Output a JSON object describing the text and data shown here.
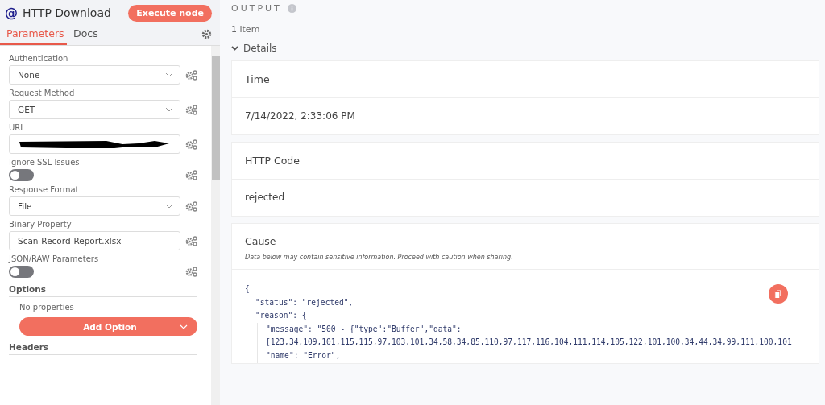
{
  "node": {
    "icon": "@",
    "title": "HTTP Download",
    "execute_button": "Execute node"
  },
  "tabs": [
    {
      "label": "Parameters",
      "selected": true
    },
    {
      "label": "Docs",
      "selected": false
    }
  ],
  "fields": [
    {
      "kind": "select",
      "label": "Authentication",
      "value": "None"
    },
    {
      "kind": "select",
      "label": "Request Method",
      "value": "GET"
    },
    {
      "kind": "redacted",
      "label": "URL"
    },
    {
      "kind": "toggle",
      "label": "Ignore SSL Issues",
      "on": false
    },
    {
      "kind": "select",
      "label": "Response Format",
      "value": "File"
    },
    {
      "kind": "input",
      "label": "Binary Property",
      "value": "Scan-Record-Report.xlsx"
    },
    {
      "kind": "toggle",
      "label": "JSON/RAW Parameters",
      "on": false
    }
  ],
  "options": {
    "title": "Options",
    "empty_text": "No properties",
    "add_button": "Add Option"
  },
  "headers": {
    "title": "Headers"
  },
  "output": {
    "title": "OUTPUT",
    "count": "1 item",
    "section": "Details",
    "expanded": true,
    "cards": [
      {
        "title": "Time",
        "value": "7/14/2022, 2:33:06 PM"
      },
      {
        "title": "HTTP Code",
        "value": "rejected"
      }
    ],
    "cause": {
      "title": "Cause",
      "note": "Data below may contain sensitive information. Proceed with caution when sharing.",
      "code": [
        {
          "text": "{",
          "children": [
            {
              "text": "\"status\": \"rejected\","
            },
            {
              "text": "\"reason\": {",
              "children": [
                {
                  "text": "\"message\": \"500 - {\"type\":\"Buffer\",\"data\":"
                },
                {
                  "text": "[123,34,109,101,115,115,97,103,101,34,58,34,85,110,97,117,116,104,111,114,105,122,101,100,34,44,34,99,111,100,101"
                },
                {
                  "text": "\"name\": \"Error\","
                }
              ]
            }
          ]
        }
      ]
    }
  }
}
